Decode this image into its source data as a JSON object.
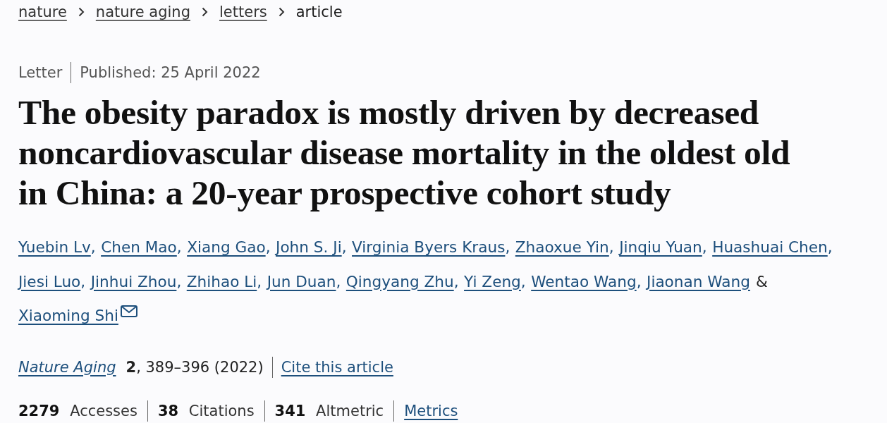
{
  "breadcrumb": [
    {
      "label": "nature",
      "current": false
    },
    {
      "label": "nature aging",
      "current": false
    },
    {
      "label": "letters",
      "current": false
    },
    {
      "label": "article",
      "current": true
    }
  ],
  "article_type": "Letter",
  "published": "Published: 25 April 2022",
  "title": "The obesity paradox is mostly driven by decreased noncardiovascular disease mortality in the oldest old in China: a 20-year prospective cohort study",
  "authors": [
    {
      "name": "Yuebin Lv",
      "comma": ",",
      "corresponding": false
    },
    {
      "name": "Chen Mao",
      "comma": ",",
      "corresponding": false
    },
    {
      "name": "Xiang Gao",
      "comma": ",",
      "corresponding": false
    },
    {
      "name": "John S. Ji",
      "comma": ",",
      "corresponding": false
    },
    {
      "name": "Virginia Byers Kraus",
      "comma": ",",
      "corresponding": false
    },
    {
      "name": "Zhaoxue Yin",
      "comma": ",",
      "corresponding": false
    },
    {
      "name": "Jinqiu Yuan",
      "comma": ",",
      "corresponding": false
    },
    {
      "name": "Huashuai Chen",
      "comma": ",",
      "corresponding": false
    },
    {
      "name": "Jiesi Luo",
      "comma": ",",
      "corresponding": false
    },
    {
      "name": "Jinhui Zhou",
      "comma": ",",
      "corresponding": false
    },
    {
      "name": "Zhihao Li",
      "comma": ",",
      "corresponding": false
    },
    {
      "name": "Jun Duan",
      "comma": ",",
      "corresponding": false
    },
    {
      "name": "Qingyang Zhu",
      "comma": ",",
      "corresponding": false
    },
    {
      "name": "Yi Zeng",
      "comma": ",",
      "corresponding": false
    },
    {
      "name": "Wentao Wang",
      "comma": ",",
      "corresponding": false
    },
    {
      "name": "Jiaonan Wang",
      "conjunction": "&",
      "corresponding": false
    },
    {
      "name": "Xiaoming Shi",
      "corresponding": true
    }
  ],
  "citation": {
    "journal": "Nature Aging",
    "volume_pages": "**2**, 389–396 (2022)",
    "cite_link": "Cite this article"
  },
  "metrics": [
    "**2279** Accesses",
    "**38** Citations",
    "**341** Altmetric"
  ],
  "metrics_link": "Metrics"
}
